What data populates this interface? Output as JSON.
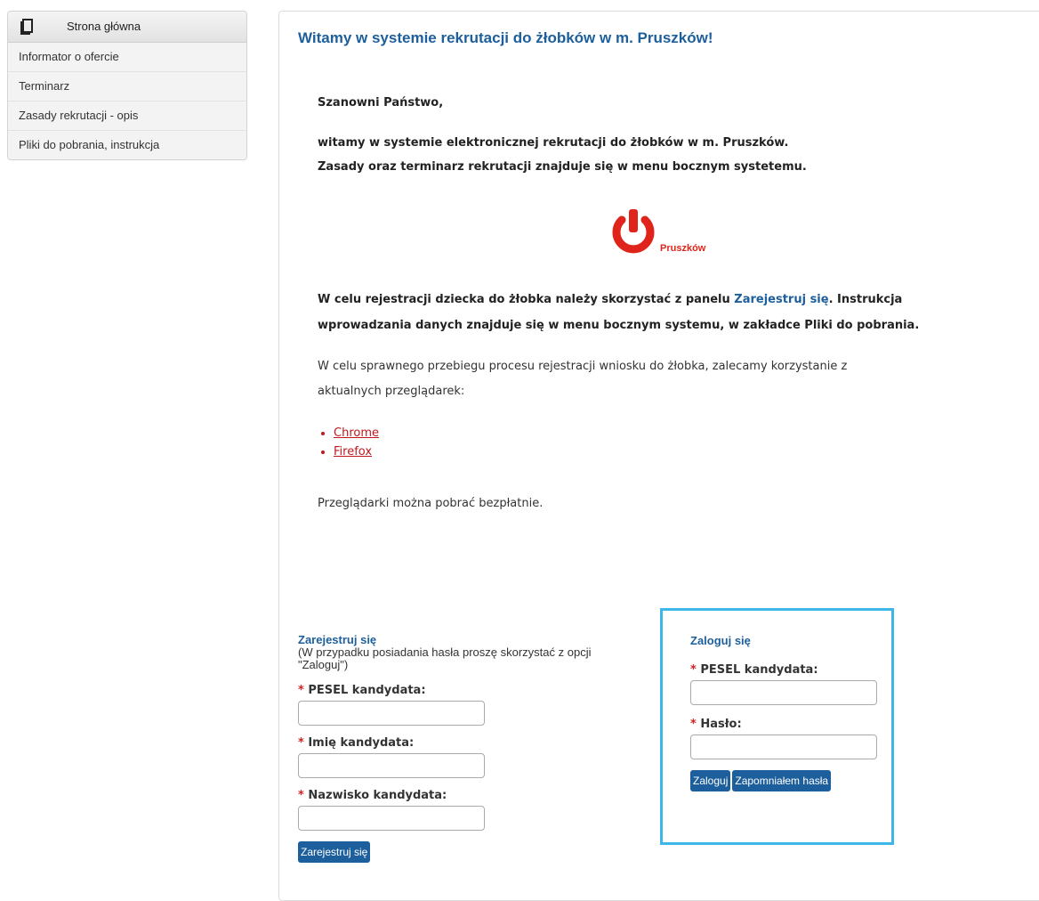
{
  "sidebar": {
    "home_label": "Strona główna",
    "items": [
      {
        "label": "Informator o ofercie"
      },
      {
        "label": "Terminarz"
      },
      {
        "label": "Zasady rekrutacji - opis"
      },
      {
        "label": "Pliki do pobrania, instrukcja"
      }
    ]
  },
  "main": {
    "title": "Witamy w systemie rekrutacji do żłobków w m. Pruszków!",
    "greeting": "Szanowni Państwo,",
    "intro_line1": "witamy w systemie elektronicznej rekrutacji do żłobków w m. Pruszków.",
    "intro_line2": "Zasady oraz terminarz rekrutacji znajduje się w menu bocznym systetemu.",
    "logo_text": "Pruszków",
    "reg_line1_pre": "W celu rejestracji dziecka do żłobka należy skorzystać z panelu ",
    "reg_line1_link": "Zarejestruj się",
    "reg_line1_post": ". Instrukcja",
    "reg_line2": "wprowadzania danych znajduje się w menu bocznym systemu, w zakładce Pliki do pobrania.",
    "browser_line1": "W celu sprawnego przebiegu procesu rejestracji wniosku do żłobka, zalecamy korzystanie z",
    "browser_line2": "aktualnych przeglądarek:",
    "browsers": [
      {
        "label": "Chrome"
      },
      {
        "label": "Firefox"
      }
    ],
    "browsers_free": "Przeglądarki można pobrać bezpłatnie."
  },
  "register": {
    "title": "Zarejestruj się",
    "subtitle": "(W przypadku posiadania hasła proszę skorzystać z opcji \"Zaloguj\")",
    "required_mark": "*",
    "pesel_label": "PESEL kandydata:",
    "first_name_label": "Imię kandydata:",
    "last_name_label": "Nazwisko kandydata:",
    "submit_label": "Zarejestruj się"
  },
  "login": {
    "title": "Zaloguj się",
    "required_mark": "*",
    "pesel_label": "PESEL kandydata:",
    "password_label": "Hasło:",
    "login_button": "Zaloguj",
    "forgot_button": "Zapomniałem hasła"
  },
  "colors": {
    "brand_blue": "#1d5f9c",
    "login_border": "#3db6e8",
    "required_red": "#d32222",
    "link_red": "#c0181e",
    "logo_red": "#e0241b"
  }
}
